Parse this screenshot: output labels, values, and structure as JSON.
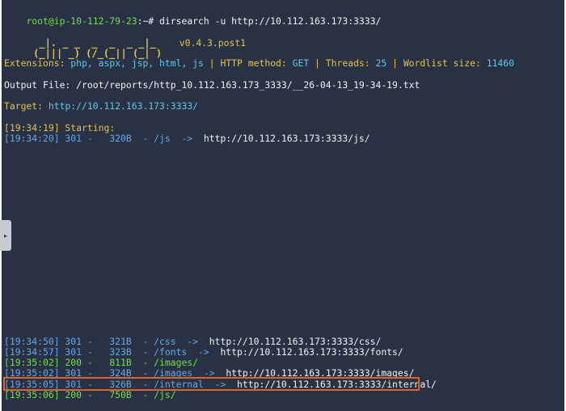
{
  "prompt": {
    "user_host": "root@ip-10-112-79-23",
    "path_suffix": ":~# ",
    "command": "dirsearch -u http://10.112.163.173:3333/"
  },
  "banner": {
    "art_line1": "  _|. _ _  _  _  _ _|_    ",
    "art_line2": " (_||| _) (/_(_|| (_| )",
    "version": "v0.4.3.post1"
  },
  "config": {
    "ext_label": "Extensions: ",
    "ext_values": "php, aspx, jsp, html, js",
    "sep1": " | ",
    "method_label": "HTTP method: ",
    "method_value": "GET",
    "sep2": " | ",
    "threads_label": "Threads: ",
    "threads_value": "25",
    "sep3": " | ",
    "wordlist_label": "Wordlist size: ",
    "wordlist_value": "11460"
  },
  "output_file": "Output File: /root/reports/http_10.112.163.173_3333/__26-04-13_19-34-19.txt",
  "target": {
    "label": "Target: ",
    "url": "http://10.112.163.173:3333/"
  },
  "starting": "[19:34:19] Starting: ",
  "results": [
    {
      "text": "[19:34:20] 301 -   320B  - /js  ->  ",
      "redirect": "http://10.112.163.173:3333/js/",
      "color": "#64a8e8"
    },
    {
      "text": "[19:34:50] 301 -   321B  - /css  ->  ",
      "redirect": "http://10.112.163.173:3333/css/",
      "color": "#64a8e8"
    },
    {
      "text": "[19:34:57] 301 -   323B  - /fonts  ->  ",
      "redirect": "http://10.112.163.173:3333/fonts/",
      "color": "#64a8e8"
    },
    {
      "text": "[19:35:02] 200 -   811B  - /images/",
      "redirect": "",
      "color": "#6fe048"
    },
    {
      "text": "[19:35:02] 301 -   324B  - /images  ->  ",
      "redirect": "http://10.112.163.173:3333/images/",
      "color": "#64a8e8"
    },
    {
      "text": "[19:35:05] 301 -   326B  - /internal  ->  ",
      "redirect": "http://10.112.163.173:3333/internal/",
      "color": "#64a8e8"
    },
    {
      "text": "[19:35:06] 200 -   750B  - /js/",
      "redirect": "",
      "color": "#6fe048"
    }
  ],
  "colors": {
    "background": "#283244",
    "highlight_border": "#e0622a"
  },
  "side_handle_icon": "chevron-right-icon"
}
